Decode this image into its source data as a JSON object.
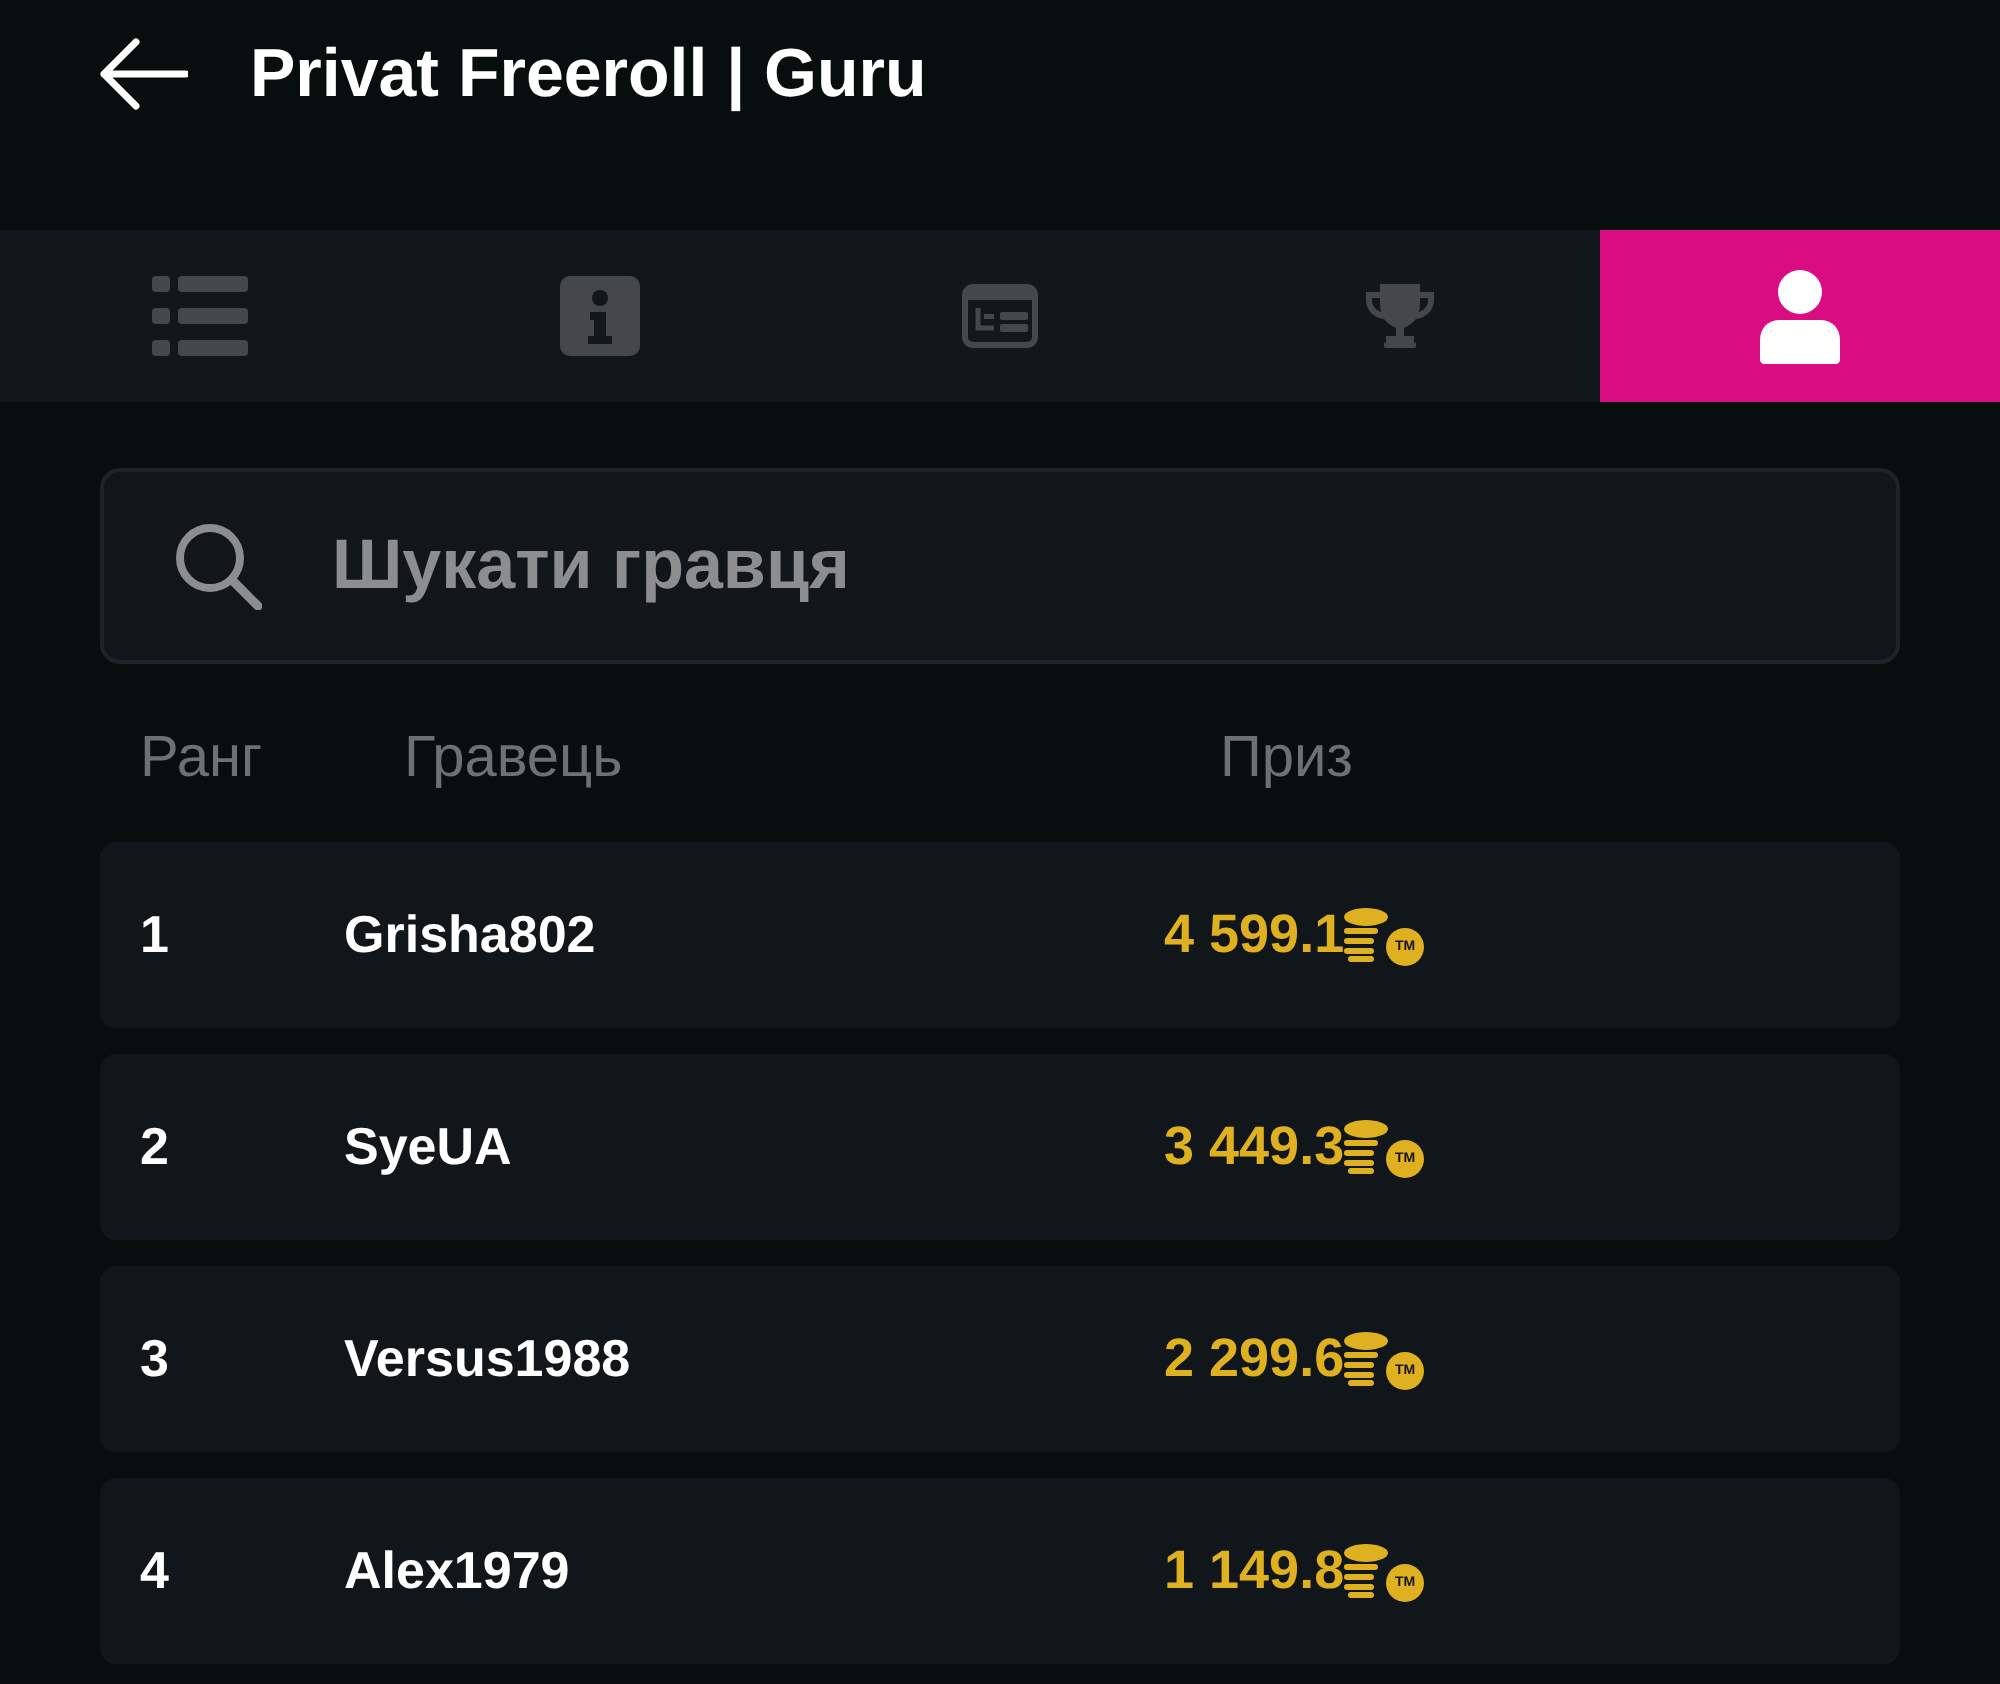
{
  "header": {
    "title": "Privat Freeroll | Guru"
  },
  "tabs": [
    {
      "selected": false
    },
    {
      "selected": false
    },
    {
      "selected": false
    },
    {
      "selected": false
    },
    {
      "selected": true
    }
  ],
  "search": {
    "placeholder": "Шукати гравця"
  },
  "table": {
    "columns": [
      "Ранг",
      "Гравець",
      "Приз"
    ],
    "rows": [
      {
        "rank": "1",
        "name": "Grisha802",
        "prize": "4 599.1",
        "coin_mark": "TM"
      },
      {
        "rank": "2",
        "name": "SyeUA",
        "prize": "3 449.3",
        "coin_mark": "TM"
      },
      {
        "rank": "3",
        "name": "Versus1988",
        "prize": "2 299.6",
        "coin_mark": "TM"
      },
      {
        "rank": "4",
        "name": "Alex1979",
        "prize": "1 149.8",
        "coin_mark": "TM"
      }
    ]
  }
}
